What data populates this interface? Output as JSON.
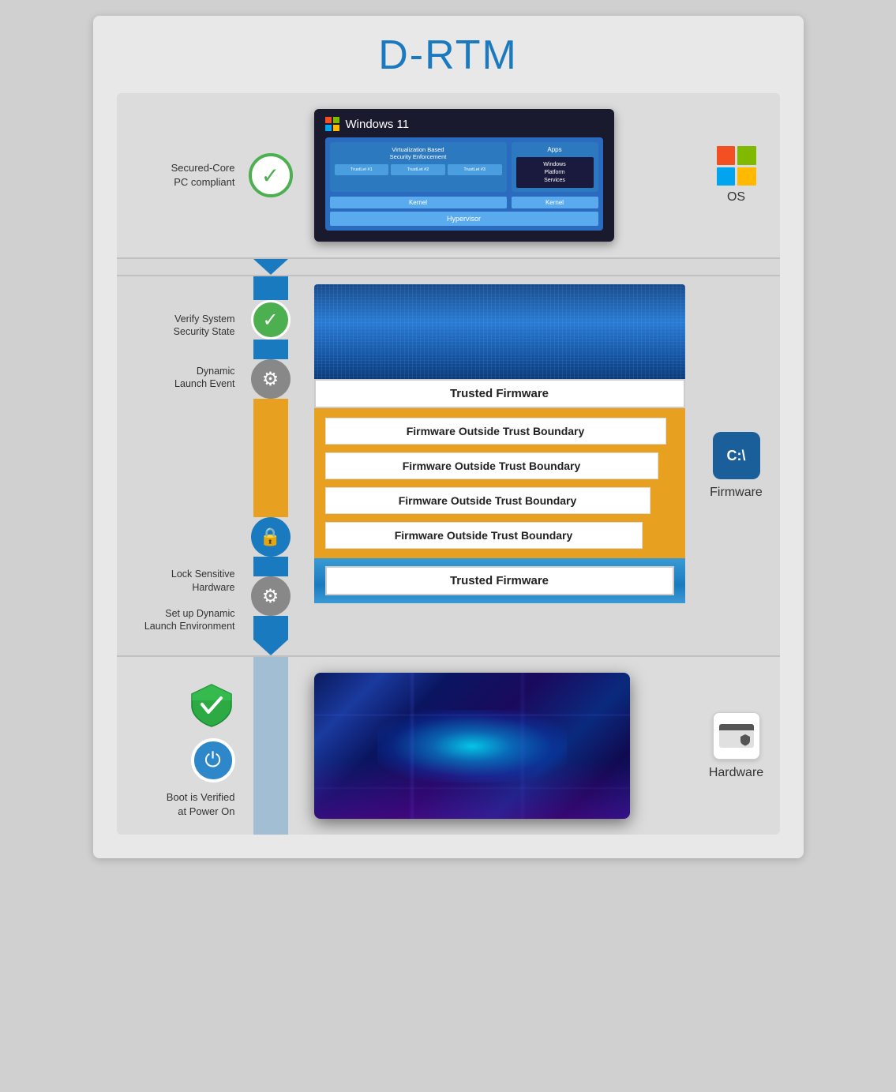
{
  "title": "D-RTM",
  "sections": {
    "os": {
      "label": "Secured-Core\nPC compliant",
      "icon": "checkmark",
      "right_label": "OS",
      "windows_title": "Windows 11",
      "vbs_label": "Virtualization Based\nSecurity Enforcement",
      "apps_label": "Apps",
      "platform_label": "Windows\nPlatform\nServices",
      "kernel_label": "Kernel",
      "kernel2_label": "Kernel",
      "hypervisor_label": "Hypervisor",
      "trust_labels": [
        "TrustLet #1",
        "TrustLet #2",
        "TrustLet #3"
      ]
    },
    "firmware": {
      "labels": [
        {
          "text": "Verify System\nSecurity State",
          "icon": "shield-check"
        },
        {
          "text": "Dynamic\nLaunch Event",
          "icon": "gear"
        },
        {
          "text": "Lock Sensitive\nHardware",
          "icon": "lock"
        },
        {
          "text": "Set up Dynamic\nLaunch Environment",
          "icon": "gear"
        }
      ],
      "trusted_fw_top": "Trusted Firmware",
      "outside_boundary": "Firmware Outside Trust Boundary",
      "outside_boundary_count": 4,
      "trusted_fw_bottom": "Trusted Firmware",
      "right_label": "Firmware"
    },
    "hardware": {
      "label": "Boot is Verified\nat Power On",
      "icon": "power",
      "shield_icon": "shield-check",
      "right_label": "Hardware"
    }
  },
  "colors": {
    "blue": "#1a7abf",
    "gold": "#e8a020",
    "green": "#4caf50",
    "title_blue": "#1a7abf",
    "dark_blue": "#1a1a2e"
  }
}
